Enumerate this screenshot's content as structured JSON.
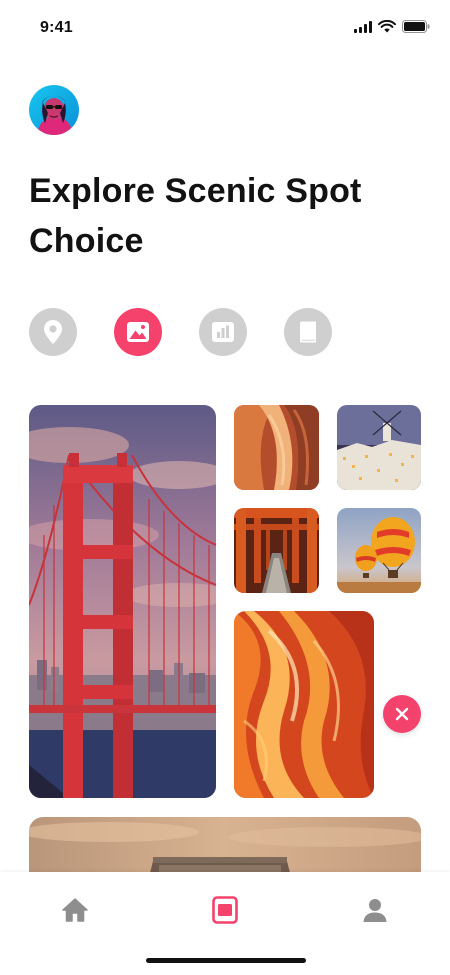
{
  "status_bar": {
    "time": "9:41"
  },
  "header": {
    "title": "Explore Scenic Spot Choice"
  },
  "categories": [
    {
      "id": "location",
      "icon": "map-pin-icon",
      "active": false
    },
    {
      "id": "landscape",
      "icon": "landscape-icon",
      "active": true
    },
    {
      "id": "stats",
      "icon": "bar-chart-icon",
      "active": false
    },
    {
      "id": "book",
      "icon": "book-icon",
      "active": false
    }
  ],
  "gallery": [
    {
      "id": "golden-gate-bridge",
      "subject": "red suspension bridge at dusk"
    },
    {
      "id": "canyon-sandstone",
      "subject": "sandstone canyon walls"
    },
    {
      "id": "santorini-village",
      "subject": "white village with windmill at night"
    },
    {
      "id": "torii-gates",
      "subject": "red torii gate tunnel"
    },
    {
      "id": "hot-air-balloons",
      "subject": "two hot air balloons"
    },
    {
      "id": "antelope-canyon",
      "subject": "orange swirling canyon"
    },
    {
      "id": "arc-de-triomphe",
      "subject": "monument at sunset"
    }
  ],
  "colors": {
    "accent": "#f5426c",
    "inactive": "#cfcfcf",
    "nav_icon": "#8e8e8e"
  },
  "nav": [
    {
      "id": "home",
      "icon": "home-icon",
      "active": false
    },
    {
      "id": "gallery",
      "icon": "gallery-icon",
      "active": true
    },
    {
      "id": "profile",
      "icon": "user-icon",
      "active": false
    }
  ]
}
